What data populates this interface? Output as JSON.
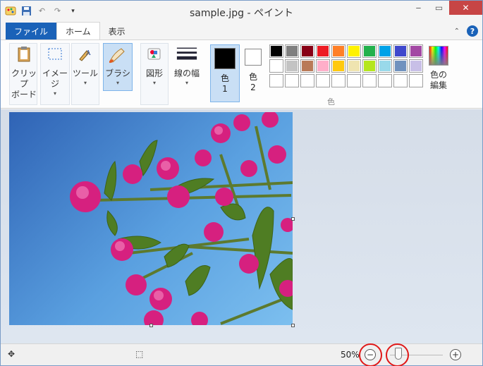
{
  "window": {
    "title": "sample.jpg - ペイント"
  },
  "tabs": [
    {
      "label": "ファイル"
    },
    {
      "label": "ホーム"
    },
    {
      "label": "表示"
    }
  ],
  "ribbon": {
    "clipboard": {
      "label1": "クリップ",
      "label2": "ボード"
    },
    "image": {
      "label": "イメージ"
    },
    "tools": {
      "label": "ツール"
    },
    "brush": {
      "label": "ブラシ"
    },
    "shapes": {
      "label": "図形"
    },
    "line_width": {
      "label": "線の幅"
    },
    "color1": {
      "label": "色",
      "num": "1"
    },
    "color2": {
      "label": "色",
      "num": "2"
    },
    "edit_colors": {
      "label1": "色の",
      "label2": "編集"
    },
    "colors_group": {
      "label": "色"
    }
  },
  "palette": [
    "#000000",
    "#7f7f7f",
    "#880015",
    "#ed1c24",
    "#ff7f27",
    "#fff200",
    "#22b14c",
    "#00a2e8",
    "#3f48cc",
    "#a349a4",
    "#ffffff",
    "#c3c3c3",
    "#b97a57",
    "#ffaec9",
    "#ffc90e",
    "#efe4b0",
    "#b5e61d",
    "#99d9ea",
    "#7092be",
    "#c8bfe7",
    "",
    "",
    "",
    "",
    "",
    "",
    "",
    "",
    "",
    ""
  ],
  "status": {
    "zoom": "50%"
  },
  "colors": {
    "accent": "#1a62b8",
    "close": "#c74545",
    "highlight": "#e01818"
  }
}
